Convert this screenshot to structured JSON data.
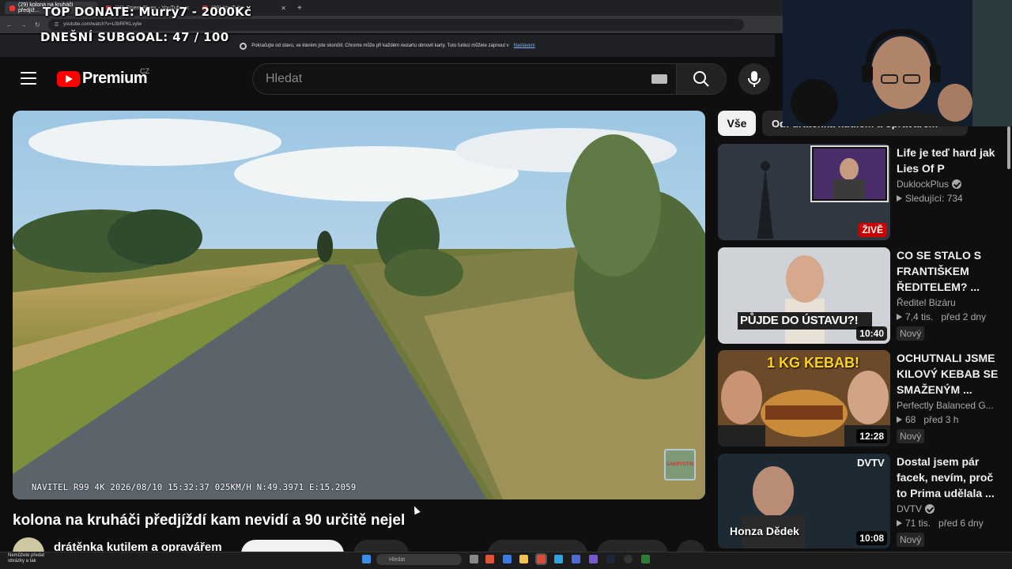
{
  "browser": {
    "tabs": [
      {
        "title": "(29) kolona na kruháči předjíž...",
        "active": true
      },
      {
        "title": "(29) Orient Blues - YouTube",
        "active": false
      },
      {
        "title": "(29) YouTube",
        "active": false
      }
    ],
    "new_tab": "+",
    "url": "youtube.com/watch?v=L0bRPKLvylw",
    "infobar_text": "Pokračujte od stavu, ve kterém jste skončili: Chrome může při každém restartu obnovit karty. Tuto funkci můžete zapnout v",
    "infobar_link": "Nastavení"
  },
  "overlay": {
    "top_donate": "TOP DONATE: Murry7 - 2000Kč",
    "subgoal": "DNEŠNÍ SUBGOAL:  47 / 100"
  },
  "header": {
    "logo_text": "Premium",
    "country": "CZ",
    "search_placeholder": "Hledat"
  },
  "video": {
    "osd": "NAVITEL R99 4K   2026/08/10 15:32:37 025KM/H N:49.3971 E:15.2059",
    "watermark": "SAKRYSTIN",
    "title": "kolona na kruháči předjíždí kam nevidí a 90 určitě nejel",
    "channel": "drátěnka kutilem a opravářem"
  },
  "sidebar": {
    "chips": [
      "Vše",
      "Od: drátěnka kutilem a opravářem"
    ],
    "items": [
      {
        "title_l1": "Life je teď hard jak",
        "title_l2": "Lies Of P",
        "title_l3": "",
        "channel": "DuklockPlus",
        "verified": true,
        "views": "Sledující: 734",
        "age": "",
        "badge": "ŽIVĚ",
        "new": ""
      },
      {
        "title_l1": "CO SE STALO S",
        "title_l2": "FRANTIŠKEM",
        "title_l3": "ŘEDITELEM? ...",
        "channel": "Ředitel Bizáru",
        "verified": false,
        "views": "7,4 tis.",
        "age": "před 2 dny",
        "badge": "10:40",
        "new": "Nový",
        "thumb_text": "PŮJDE DO ÚSTAVU?!"
      },
      {
        "title_l1": "OCHUTNALI JSME",
        "title_l2": "KILOVÝ KEBAB SE",
        "title_l3": "SMAŽENÝM ...",
        "channel": "Perfectly Balanced G...",
        "verified": false,
        "views": "68",
        "age": "před 3 h",
        "badge": "12:28",
        "new": "Nový",
        "thumb_text": "1 KG KEBAB!"
      },
      {
        "title_l1": "Dostal jsem pár",
        "title_l2": "facek, nevím, proč",
        "title_l3": "to Prima udělala ...",
        "channel": "DVTV",
        "verified": true,
        "views": "71 tis.",
        "age": "před 6 dny",
        "badge": "10:08",
        "new": "Nový",
        "thumb_text": "Honza Dědek",
        "thumb_logo": "DVTV"
      }
    ]
  },
  "taskbar": {
    "search": "Hledat",
    "notif_l1": "Nemůžete předat",
    "notif_l2": "obrázky a tak"
  },
  "colors": {
    "accent": "#ff0000",
    "bg": "#0f0f0f",
    "live": "#cc0000"
  },
  "icons": [
    "menu-icon",
    "youtube-logo-icon",
    "search-icon",
    "mic-icon",
    "keyboard-icon",
    "verified-icon",
    "live-icon",
    "chevron-right-icon"
  ]
}
